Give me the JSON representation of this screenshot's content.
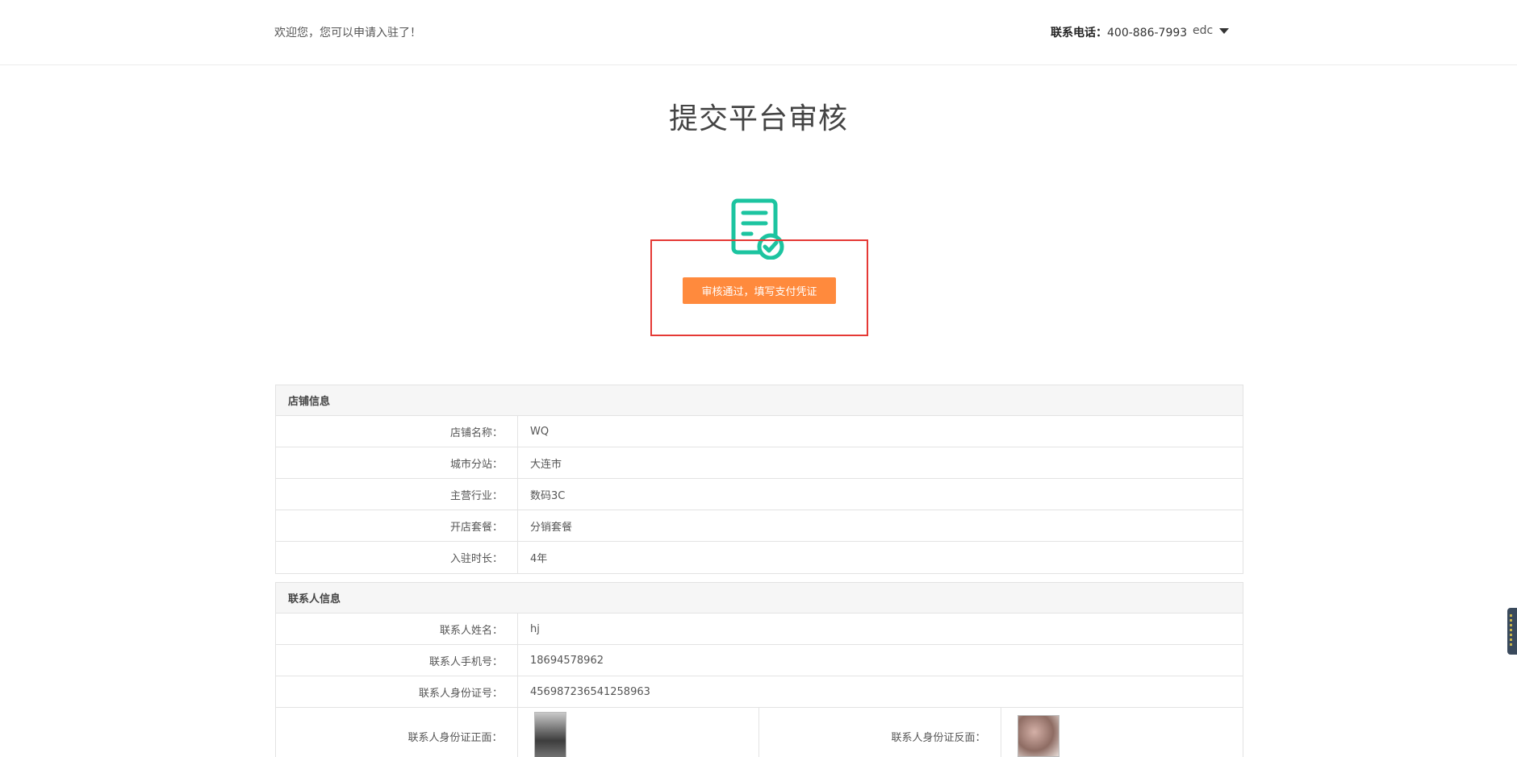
{
  "header": {
    "welcome": "欢迎您，您可以申请入驻了！",
    "contact_label": "联系电话：",
    "contact_phone": "400-886-7993",
    "username": "edc"
  },
  "page_title": "提交平台审核",
  "status": {
    "icon": "certificate-check-icon",
    "button_label": "审核通过，填写支付凭证"
  },
  "store_info": {
    "heading": "店铺信息",
    "rows": [
      {
        "label": "店铺名称：",
        "value": "WQ"
      },
      {
        "label": "城市分站：",
        "value": "大连市"
      },
      {
        "label": "主营行业：",
        "value": "数码3C"
      },
      {
        "label": "开店套餐：",
        "value": "分销套餐"
      },
      {
        "label": "入驻时长：",
        "value": "4年"
      }
    ]
  },
  "contact_info": {
    "heading": "联系人信息",
    "rows": [
      {
        "label": "联系人姓名：",
        "value": "hj"
      },
      {
        "label": "联系人手机号：",
        "value": "18694578962"
      },
      {
        "label": "联系人身份证号：",
        "value": "456987236541258963"
      }
    ],
    "id_front_label": "联系人身份证正面：",
    "id_back_label": "联系人身份证反面："
  },
  "colors": {
    "accent": "#ff8a3d",
    "icon": "#1cc4a0",
    "highlight": "#e53935"
  }
}
